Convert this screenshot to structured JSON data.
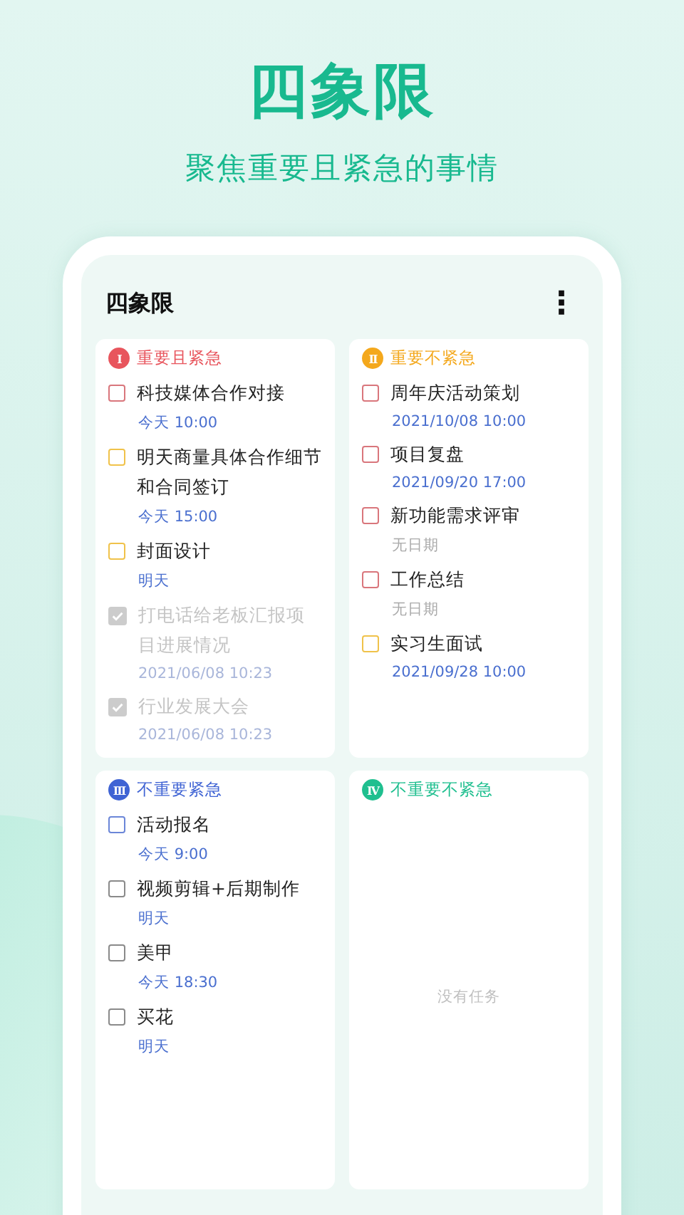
{
  "headline": "四象限",
  "tagline": "聚焦重要且紧急的事情",
  "app": {
    "title": "四象限",
    "menu_icon": "⋮"
  },
  "quadrants": [
    {
      "numeral": "I",
      "title": "重要且紧急",
      "color": "#e8555d",
      "tasks": [
        {
          "title": "科技媒体合作对接",
          "due": "今天 10:00",
          "has_date": true,
          "checked": false,
          "color": "#d9767c"
        },
        {
          "title": "明天商量具体合作细节和合同签订",
          "due": "今天 15:00",
          "has_date": true,
          "checked": false,
          "color": "#f0c24a"
        },
        {
          "title": "封面设计",
          "due": "明天",
          "has_date": true,
          "checked": false,
          "color": "#f0c24a"
        },
        {
          "title": "打电话给老板汇报项目进展情况",
          "due": "2021/06/08 10:23",
          "checked": true,
          "color": "#cccccc"
        },
        {
          "title": "行业发展大会",
          "due": "2021/06/08 10:23",
          "checked": true,
          "color": "#cccccc"
        }
      ]
    },
    {
      "numeral": "II",
      "title": "重要不紧急",
      "color": "#f4a81c",
      "tasks": [
        {
          "title": "周年庆活动策划",
          "due": "2021/10/08 10:00",
          "has_date": true,
          "checked": false,
          "color": "#d9767c"
        },
        {
          "title": "项目复盘",
          "due": "2021/09/20 17:00",
          "has_date": true,
          "checked": false,
          "color": "#d9767c"
        },
        {
          "title": "新功能需求评审",
          "due": "无日期",
          "has_date": false,
          "checked": false,
          "color": "#d9767c"
        },
        {
          "title": "工作总结",
          "due": "无日期",
          "has_date": false,
          "checked": false,
          "color": "#d9767c"
        },
        {
          "title": "实习生面试",
          "due": "2021/09/28 10:00",
          "has_date": true,
          "checked": false,
          "color": "#f0c24a"
        }
      ]
    },
    {
      "numeral": "III",
      "title": "不重要紧急",
      "color": "#3f63d4",
      "tasks": [
        {
          "title": "活动报名",
          "due": "今天 9:00",
          "has_date": true,
          "checked": false,
          "color": "#6b86d8"
        },
        {
          "title": "视频剪辑+后期制作",
          "due": "明天",
          "has_date": true,
          "checked": false,
          "color": "#8a8a8a"
        },
        {
          "title": "美甲",
          "due": "今天 18:30",
          "has_date": true,
          "checked": false,
          "color": "#8a8a8a"
        },
        {
          "title": "买花",
          "due": "明天",
          "has_date": true,
          "checked": false,
          "color": "#8a8a8a"
        }
      ]
    },
    {
      "numeral": "IV",
      "title": "不重要不紧急",
      "color": "#1fbf8f",
      "empty_text": "没有任务"
    }
  ]
}
